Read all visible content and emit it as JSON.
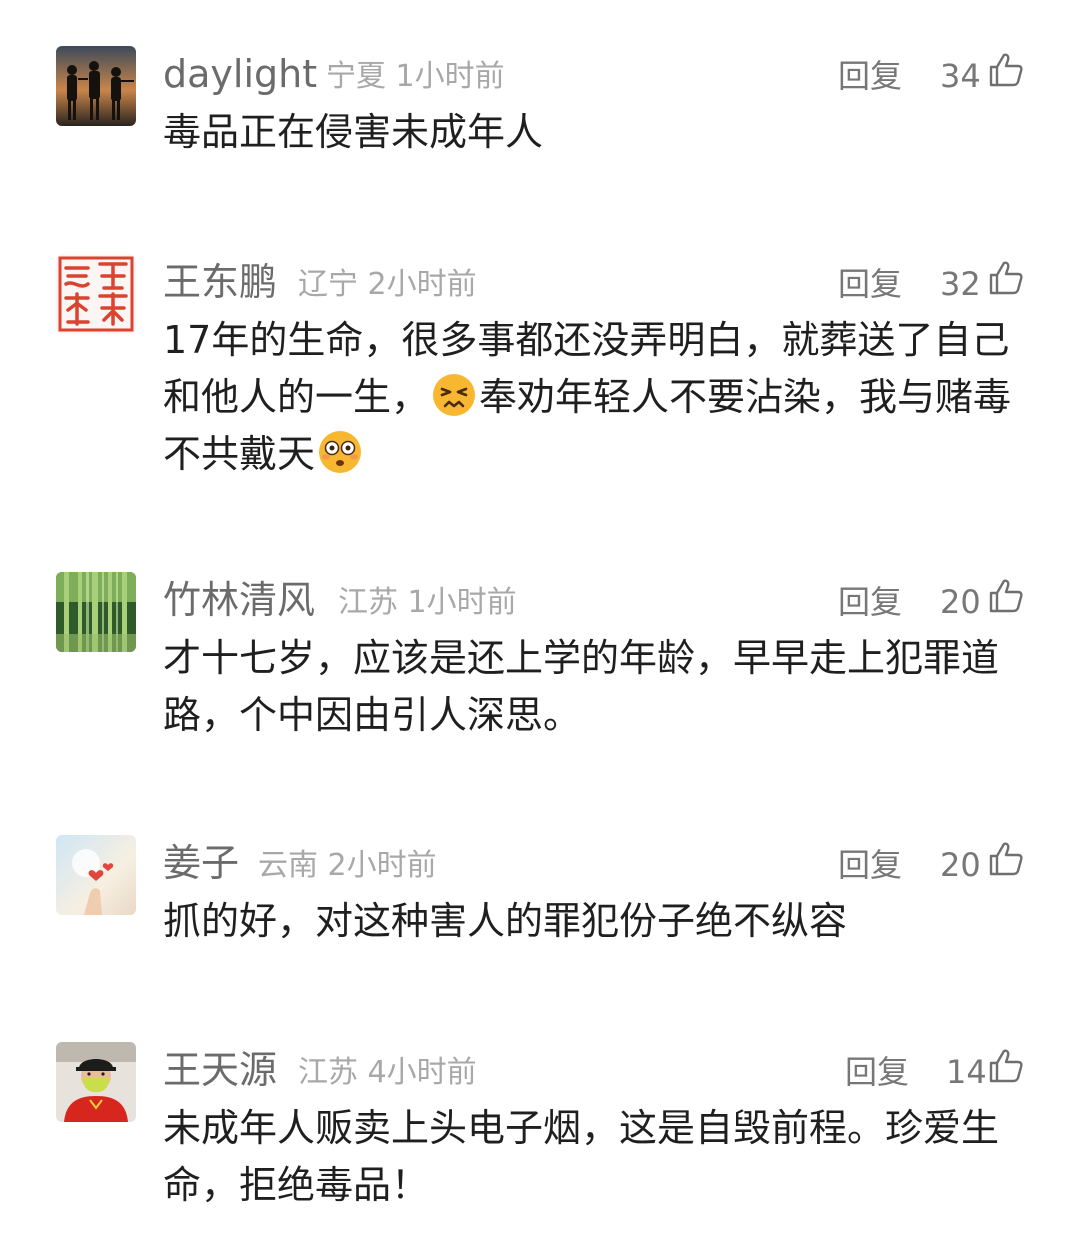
{
  "comments": [
    {
      "username": "daylight",
      "location": "宁夏",
      "time": "1小时前",
      "reply_label": "回复",
      "likes": "34",
      "text_parts": [
        "毒品正在侵害未成年人"
      ],
      "avatar": "soldiers-silhouette-avatar"
    },
    {
      "username": "王东鹏",
      "location": "辽宁",
      "time": "2小时前",
      "reply_label": "回复",
      "likes": "32",
      "text_parts": [
        "17年的生命，很多事都还没弄明白，就葬送了自己和他人的一生，",
        "奉劝年轻人不要沾染，我与赌毒不共戴天"
      ],
      "emojis": [
        "persevering-face-emoji",
        "flushed-face-emoji"
      ],
      "avatar": "red-seal-stamp-avatar"
    },
    {
      "username": "竹林清风",
      "location": "江苏",
      "time": "1小时前",
      "reply_label": "回复",
      "likes": "20",
      "text_parts": [
        "才十七岁，应该是还上学的年龄，早早走上犯罪道路，个中因由引人深思。"
      ],
      "avatar": "bamboo-forest-avatar"
    },
    {
      "username": "姜子",
      "location": "云南",
      "time": "2小时前",
      "reply_label": "回复",
      "likes": "20",
      "text_parts": [
        "抓的好，对这种害人的罪犯份子绝不纵容"
      ],
      "avatar": "hand-hearts-avatar"
    },
    {
      "username": "王天源",
      "location": "江苏",
      "time": "4小时前",
      "reply_label": "回复",
      "likes": "14",
      "text_parts": [
        "未成年人贩卖上头电子烟，这是自毁前程。珍爱生命，拒绝毒品！"
      ],
      "avatar": "masked-man-avatar"
    }
  ],
  "colors": {
    "username": "#6b6b6b",
    "meta": "#a8a8a8",
    "action": "#777777",
    "body_text": "#1f1f1f",
    "seal_red": "#d9432f"
  }
}
